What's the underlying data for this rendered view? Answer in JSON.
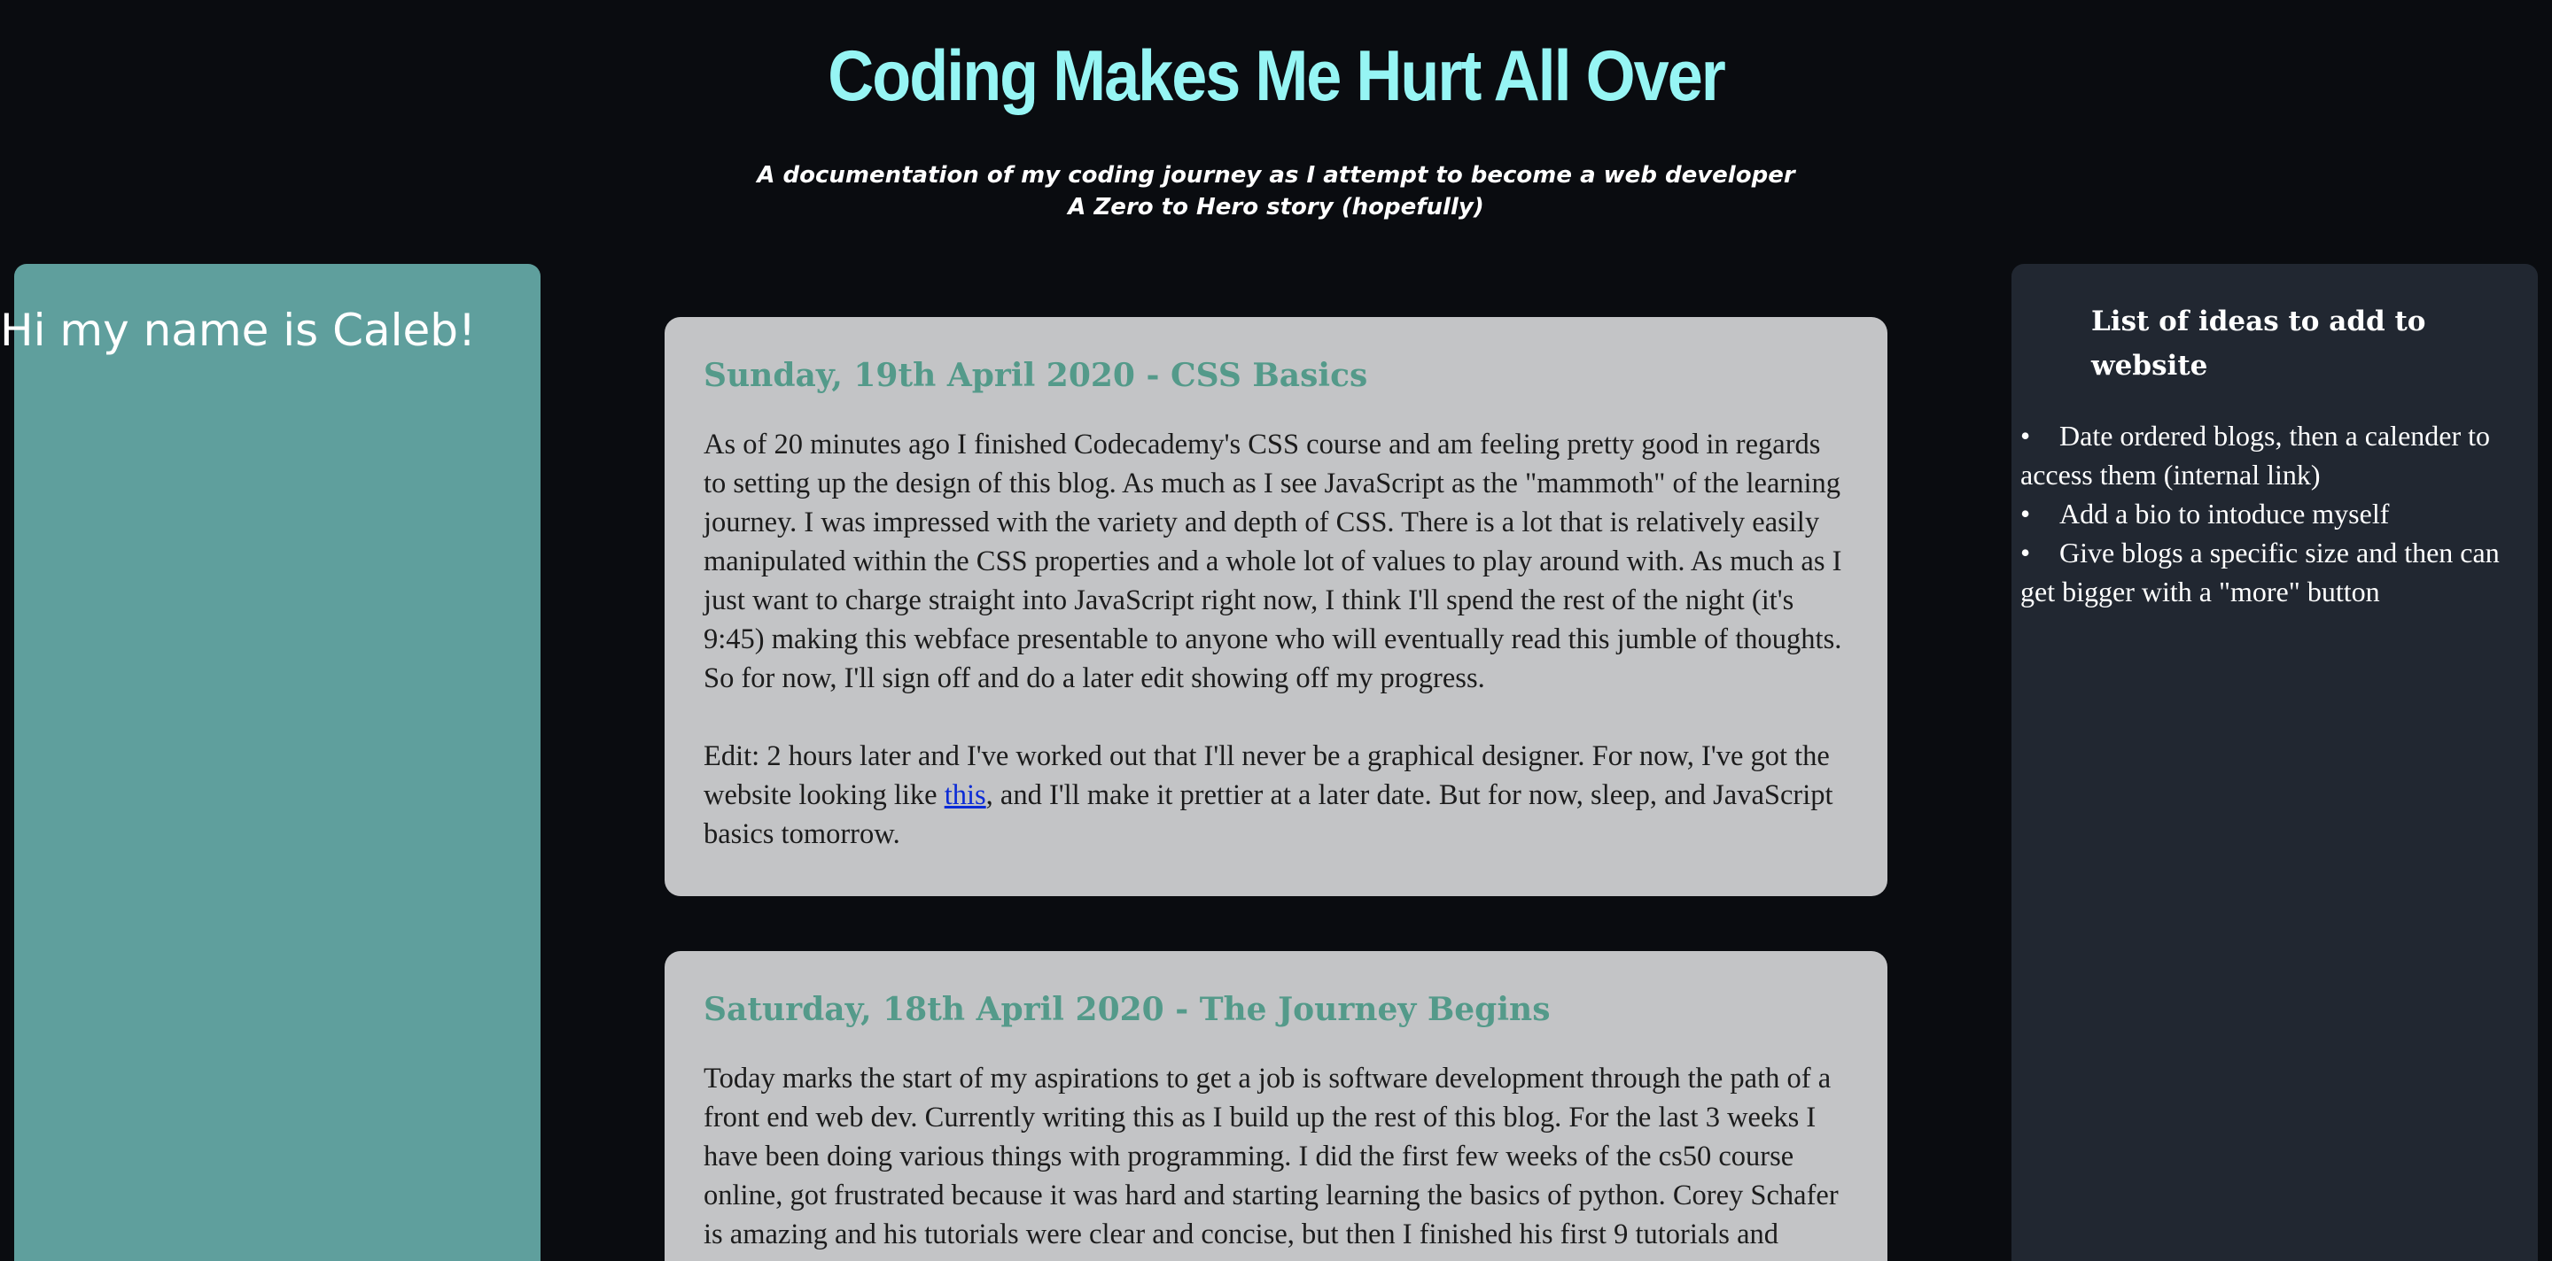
{
  "header": {
    "title": "Coding Makes Me Hurt All Over",
    "subtitle_line1": "A documentation of my coding journey as I attempt to become a web developer",
    "subtitle_line2": "A Zero to Hero story (hopefully)"
  },
  "sidebar_left": {
    "heading": "Hi my name is Caleb!"
  },
  "sidebar_right": {
    "heading": "List of ideas to add to website",
    "items": [
      "Date ordered blogs, then a calender to access them (internal link)",
      "Add a bio to intoduce myself",
      "Give blogs a specific size and then can get bigger with a \"more\" button"
    ]
  },
  "posts": [
    {
      "title": "Sunday, 19th April 2020 - CSS Basics",
      "paragraph1": "As of 20 minutes ago I finished Codecademy's CSS course and am feeling pretty good in regards to setting up the design of this blog. As much as I see JavaScript as the \"mammoth\" of the learning journey. I was impressed with the variety and depth of CSS. There is a lot that is relatively easily manipulated within the CSS properties and a whole lot of values to play around with. As much as I just want to charge straight into JavaScript right now, I think I'll spend the rest of the night (it's 9:45) making this webface presentable to anyone who will eventually read this jumble of thoughts. So for now, I'll sign off and do a later edit showing off my progress.",
      "paragraph2_before": "Edit: 2 hours later and I've worked out that I'll never be a graphical designer. For now, I've got the website looking like ",
      "paragraph2_link": "this",
      "paragraph2_after": ", and I'll make it prettier at a later date. But for now, sleep, and JavaScript basics tomorrow."
    },
    {
      "title": "Saturday, 18th April 2020 - The Journey Begins",
      "paragraph1": "Today marks the start of my aspirations to get a job is software development through the path of a front end web dev. Currently writing this as I build up the rest of this blog. For the last 3 weeks I have been doing various things with programming. I did the first few weeks of the cs50 course online, got frustrated because it was hard and starting learning the basics of python. Corey Schafer is amazing and his tutorials were clear and concise, but then I finished his first 9 tutorials and"
    }
  ],
  "colors": {
    "page_background": "#0a0c10",
    "title": "#96f5f4",
    "left_panel": "#5f9f9d",
    "right_panel": "#212731",
    "post_card": "#c3c4c6",
    "post_title": "#549a8a",
    "link": "#0b2bd6"
  }
}
